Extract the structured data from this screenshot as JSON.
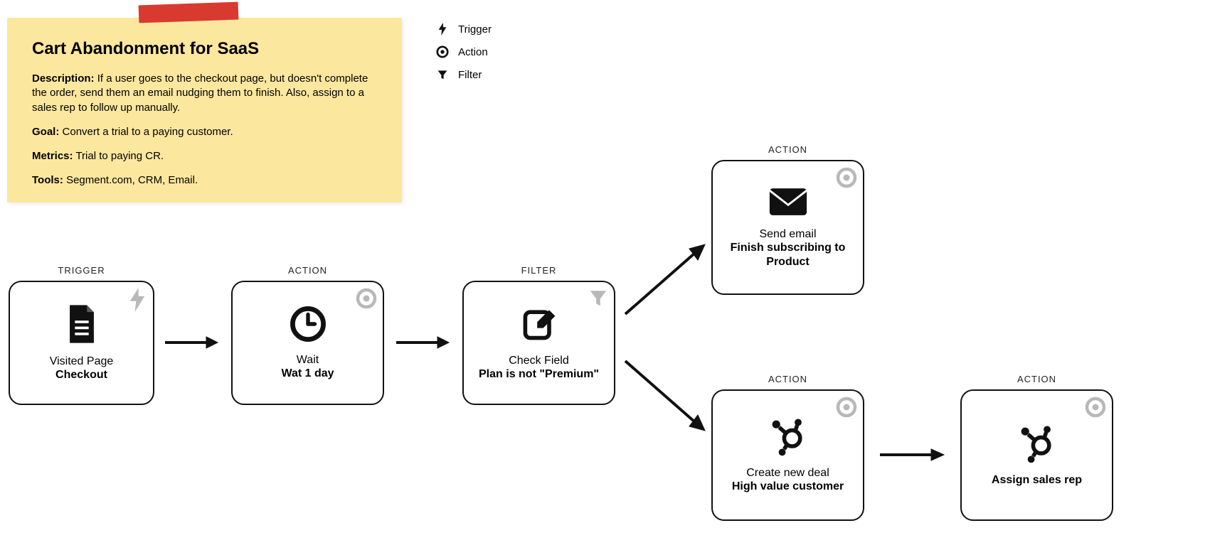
{
  "sticky": {
    "title": "Cart Abandonment for SaaS",
    "description_label": "Description:",
    "description_text": "If a user goes to the checkout page, but doesn't complete the order, send them an email nudging them to finish. Also, assign to a sales rep to follow up manually.",
    "goal_label": "Goal:",
    "goal_text": "Convert a trial to a paying customer.",
    "metrics_label": "Metrics:",
    "metrics_text": "Trial to paying CR.",
    "tools_label": "Tools:",
    "tools_text": "Segment.com, CRM, Email."
  },
  "legend": {
    "trigger": "Trigger",
    "action": "Action",
    "filter": "Filter"
  },
  "labels": {
    "trigger": "TRIGGER",
    "action": "ACTION",
    "filter": "FILTER"
  },
  "nodes": {
    "n1": {
      "line1": "Visited Page",
      "line2": "Checkout"
    },
    "n2": {
      "line1": "Wait",
      "line2": "Wat 1 day"
    },
    "n3": {
      "line1": "Check Field",
      "line2_a": "Plan",
      "line2_b": " is not ",
      "line2_c": "\"Premium\""
    },
    "n4": {
      "line1": "Send email",
      "line2": "Finish subscribing to Product"
    },
    "n5": {
      "line1": "Create new deal",
      "line2": "High value customer"
    },
    "n6": {
      "line1": "Assign sales rep"
    }
  }
}
